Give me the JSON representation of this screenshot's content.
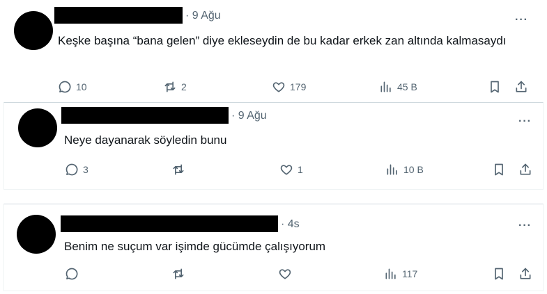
{
  "tweets": [
    {
      "time": "· 9 Ağu",
      "text": "Keşke başına “bana gelen” diye ekleseydin de bu kadar erkek zan altında kalmasaydı",
      "replies": "10",
      "retweets": "2",
      "likes": "179",
      "views": "45 B"
    },
    {
      "time": "· 9 Ağu",
      "text": "Neye dayanarak söyledin bunu",
      "replies": "3",
      "retweets": "",
      "likes": "1",
      "views": "10 B"
    },
    {
      "time": "· 4s",
      "text": "Benim ne  suçum var işimde gücümde çalışıyorum",
      "replies": "",
      "retweets": "",
      "likes": "",
      "views": "117"
    }
  ],
  "more_label": "···",
  "icons": [
    "reply-icon",
    "retweet-icon",
    "like-icon",
    "views-icon",
    "bookmark-icon",
    "share-icon"
  ]
}
